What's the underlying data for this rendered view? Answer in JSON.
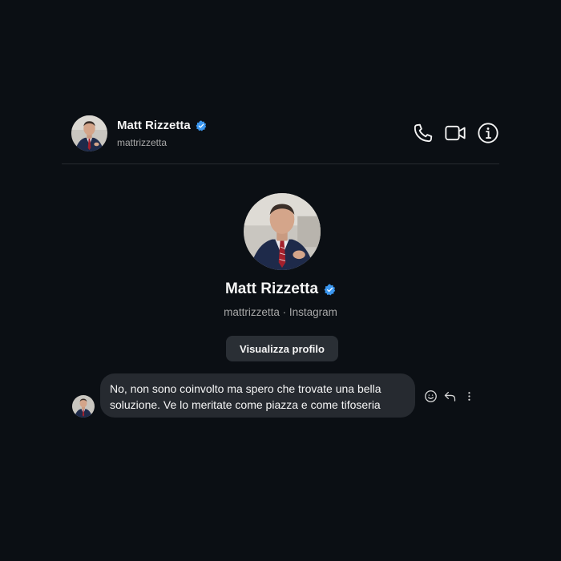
{
  "header": {
    "name": "Matt Rizzetta",
    "username": "mattrizzetta",
    "actions": {
      "call": "phone-icon",
      "video": "video-camera-icon",
      "info": "info-icon"
    }
  },
  "profile": {
    "name": "Matt Rizzetta",
    "subtitle": "mattrizzetta · Instagram",
    "view_profile_label": "Visualizza profilo"
  },
  "messages": [
    {
      "text": "No, non sono coinvolto ma spero che trovate una bella soluzione. Ve lo meritate come piazza e come tifoseria"
    }
  ],
  "colors": {
    "background": "#0b0f14",
    "bubble": "#262a30",
    "button": "#2a2f35",
    "verified": "#3b97f0",
    "muted_text": "#a8a8a8"
  }
}
